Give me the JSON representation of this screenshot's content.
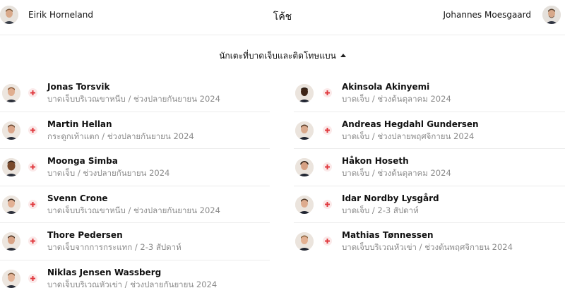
{
  "coaches": {
    "home_name": "Eirik Horneland",
    "title": "โค้ช",
    "away_name": "Johannes Moesgaard"
  },
  "section": {
    "label": "นักเตะที่บาดเจ็บและติดโทษแบน"
  },
  "colors": {
    "injury_accent": "#e0393e",
    "divider": "#ececec",
    "secondary_text": "#8a8a8a"
  },
  "icons": {
    "injury": "medical-cross-icon",
    "toggle": "caret-up-icon"
  },
  "home_players": [
    {
      "name": "Jonas Torsvik",
      "detail": "บาดเจ็บบริเวณขาหนีบ / ช่วงปลายกันยายน 2024"
    },
    {
      "name": "Martin Hellan",
      "detail": "กระดูกเท้าแตก / ช่วงปลายกันยายน 2024"
    },
    {
      "name": "Moonga Simba",
      "detail": "บาดเจ็บ / ช่วงปลายกันยายน 2024"
    },
    {
      "name": "Svenn Crone",
      "detail": "บาดเจ็บบริเวณขาหนีบ / ช่วงปลายกันยายน 2024"
    },
    {
      "name": "Thore Pedersen",
      "detail": "บาดเจ็บจากการกระแทก / 2-3 สัปดาห์"
    },
    {
      "name": "Niklas Jensen Wassberg",
      "detail": "บาดเจ็บบริเวณหัวเข่า / ช่วงปลายกันยายน 2024"
    }
  ],
  "away_players": [
    {
      "name": "Akinsola Akinyemi",
      "detail": "บาดเจ็บ / ช่วงต้นตุลาคม 2024"
    },
    {
      "name": "Andreas Hegdahl Gundersen",
      "detail": "บาดเจ็บ / ช่วงปลายพฤศจิกายน 2024"
    },
    {
      "name": "Håkon Hoseth",
      "detail": "บาดเจ็บ / ช่วงต้นตุลาคม 2024"
    },
    {
      "name": "Idar Nordby Lysgård",
      "detail": "บาดเจ็บ / 2-3 สัปดาห์"
    },
    {
      "name": "Mathias Tønnessen",
      "detail": "บาดเจ็บบริเวณหัวเข่า / ช่วงต้นพฤศจิกายน 2024"
    }
  ]
}
